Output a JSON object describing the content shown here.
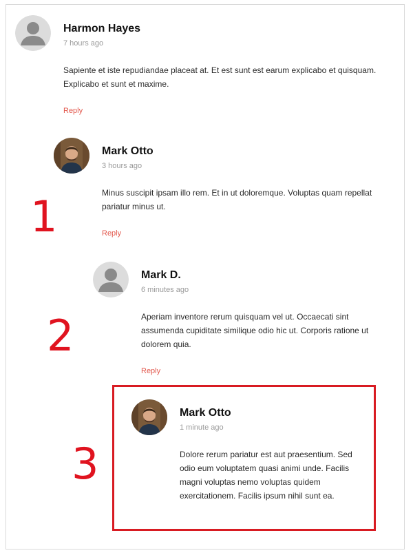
{
  "comments": [
    {
      "author": "Harmon Hayes",
      "time": "7 hours ago",
      "avatar": "default-user-icon",
      "text": "Sapiente et iste repudiandae placeat at. Et est sunt est earum explicabo et quisquam. Explicabo et sunt et maxime.",
      "reply_label": "Reply"
    },
    {
      "author": "Mark Otto",
      "time": "3 hours ago",
      "avatar": "profile-photo",
      "text": "Minus suscipit ipsam illo rem. Et in ut doloremque. Voluptas quam repellat pariatur minus ut.",
      "reply_label": "Reply"
    },
    {
      "author": "Mark D.",
      "time": "6 minutes ago",
      "avatar": "default-user-icon",
      "text": "Aperiam inventore rerum quisquam vel ut. Occaecati sint assumenda cupiditate similique odio hic ut. Corporis ratione ut dolorem quia.",
      "reply_label": "Reply"
    },
    {
      "author": "Mark Otto",
      "time": "1 minute ago",
      "avatar": "profile-photo",
      "text": "Dolore rerum pariatur est aut praesentium. Sed odio eum voluptatem quasi animi unde. Facilis magni voluptas nemo voluptas quidem exercitationem. Facilis ipsum nihil sunt ea."
    }
  ],
  "annotations": [
    "1",
    "2",
    "3"
  ],
  "colors": {
    "reply_link": "#e2574c",
    "annotation": "#e0131f",
    "meta_text": "#9a9a9a"
  }
}
